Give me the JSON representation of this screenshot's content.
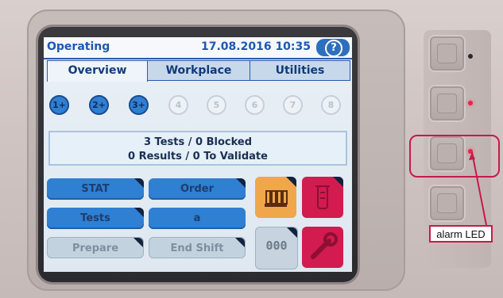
{
  "status": {
    "mode": "Operating",
    "datetime": "17.08.2016 10:35",
    "help_icon": "?"
  },
  "tabs": [
    {
      "label": "Overview",
      "active": true
    },
    {
      "label": "Workplace",
      "active": false
    },
    {
      "label": "Utilities",
      "active": false
    }
  ],
  "positions": [
    {
      "label": "1+",
      "active": true
    },
    {
      "label": "2+",
      "active": true
    },
    {
      "label": "3+",
      "active": true
    },
    {
      "label": "4",
      "active": false
    },
    {
      "label": "5",
      "active": false
    },
    {
      "label": "6",
      "active": false
    },
    {
      "label": "7",
      "active": false
    },
    {
      "label": "8",
      "active": false
    }
  ],
  "info": {
    "line1": "3 Tests / 0 Blocked",
    "line2": "0 Results / 0 To Validate"
  },
  "buttons": {
    "stat": "STAT",
    "order": "Order",
    "tests": "Tests",
    "a": "a",
    "prepare": "Prepare",
    "end_shift": "End Shift",
    "counter": "000"
  },
  "icons": {
    "help": "question-icon",
    "rack": "rack-icon",
    "tube": "tube-icon",
    "counter": "counter-icon",
    "wrench": "wrench-icon"
  },
  "annotation": {
    "label": "alarm LED"
  },
  "colors": {
    "accent": "#2f7fd3",
    "alert": "#d21b4e",
    "orange": "#f0a64a"
  }
}
